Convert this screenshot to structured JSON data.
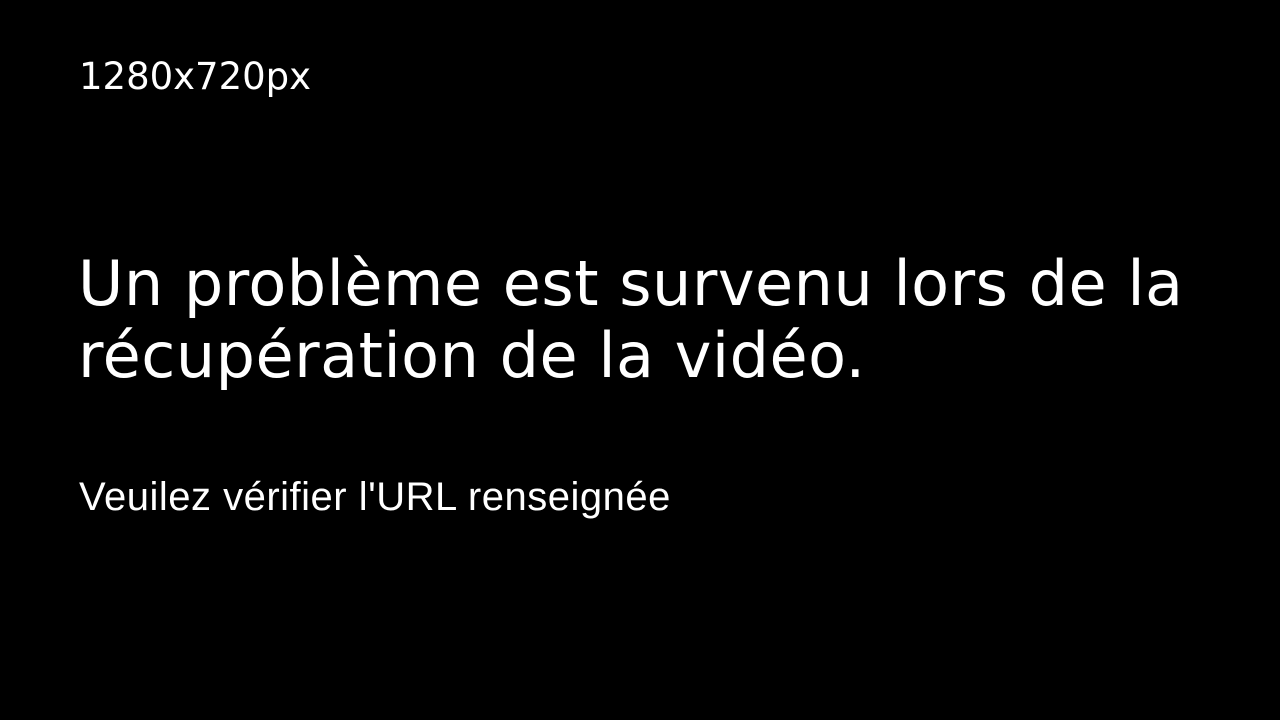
{
  "player": {
    "dimensions_label": "1280x720px",
    "error_title": "Un problème est survenu lors de la récupération de la vidéo.",
    "error_hint": "Veuilez vérifier l'URL renseignée",
    "background_color": "#000000",
    "text_color": "#ffffff"
  }
}
